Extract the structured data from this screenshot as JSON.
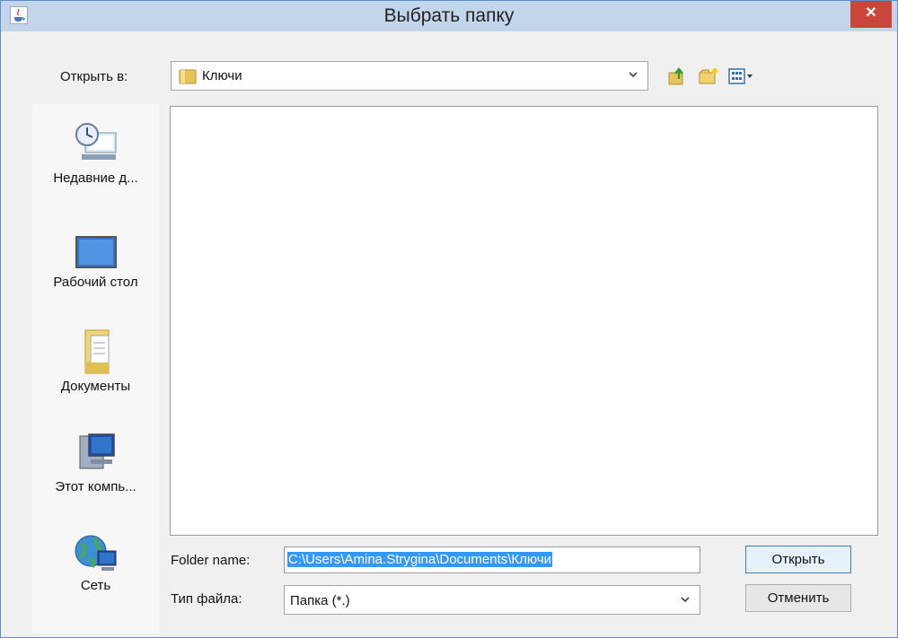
{
  "window": {
    "title": "Выбрать папку",
    "close_icon": "close-icon",
    "app_icon": "java-app-icon"
  },
  "lookin": {
    "label": "Открыть в:",
    "value": "Ключи",
    "icons": [
      "folder-icon",
      "up-one-level-icon",
      "new-folder-icon",
      "view-menu-icon"
    ]
  },
  "places": [
    {
      "label": "Недавние д...",
      "icon": "recent-items-icon"
    },
    {
      "label": "Рабочий стол",
      "icon": "desktop-icon"
    },
    {
      "label": "Документы",
      "icon": "documents-icon"
    },
    {
      "label": "Этот компь...",
      "icon": "computer-icon"
    },
    {
      "label": "Сеть",
      "icon": "network-icon"
    }
  ],
  "folder_name": {
    "label": "Folder name:",
    "value": "C:\\Users\\Amina.Strygina\\Documents\\Ключи"
  },
  "file_type": {
    "label": "Тип файла:",
    "value": "Папка (*.)"
  },
  "buttons": {
    "open": "Открыть",
    "cancel": "Отменить"
  },
  "colors": {
    "titlebar": "#c3d5ea",
    "close": "#c9473a",
    "selection": "#3399ff"
  }
}
